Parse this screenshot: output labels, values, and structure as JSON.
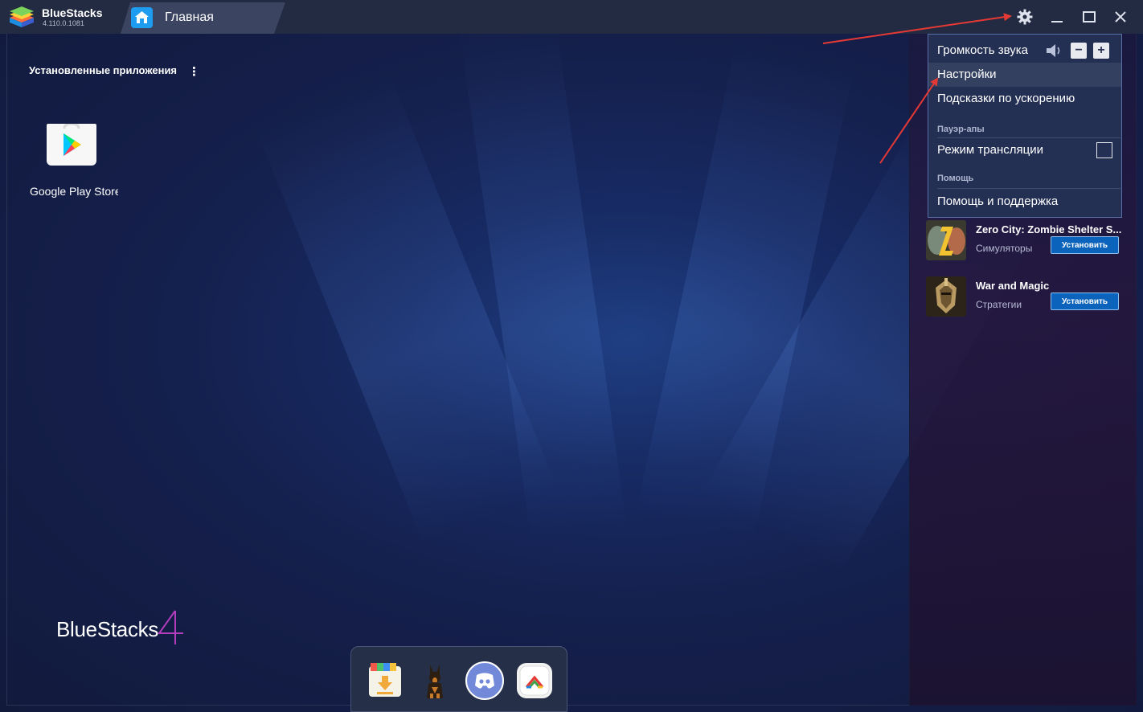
{
  "app": {
    "name": "BlueStacks",
    "version": "4.110.0.1081",
    "tab_label": "Главная",
    "watermark_text": "BlueStacks",
    "watermark_number": "4"
  },
  "installed": {
    "section_title": "Установленные приложения",
    "apps": [
      {
        "label": "Google Play Store",
        "icon": "google-play-store-icon"
      }
    ]
  },
  "dock": {
    "items": [
      {
        "name": "app-center-icon"
      },
      {
        "name": "doberman-game-icon"
      },
      {
        "name": "discord-icon"
      },
      {
        "name": "camera-app-icon"
      }
    ]
  },
  "settings_menu": {
    "volume_label": "Громкость звука",
    "items": [
      {
        "label": "Настройки",
        "highlighted": true
      },
      {
        "label": "Подсказки по ускорению"
      }
    ],
    "powerups_section": "Пауэр-апы",
    "stream_mode_label": "Режим трансляции",
    "stream_mode_checked": false,
    "help_section": "Помощь",
    "help_label": "Помощь и поддержка"
  },
  "recommended": [
    {
      "name": "Zero City: Zombie Shelter S...",
      "category": "Симуляторы",
      "button": "Установить"
    },
    {
      "name": "War and Magic",
      "category": "Стратегии",
      "button": "Установить"
    }
  ],
  "colors": {
    "titlebar": "#232b42",
    "accent_blue": "#1e9df0",
    "install_button": "#0b63bb",
    "annotation_arrow": "#e53935"
  }
}
